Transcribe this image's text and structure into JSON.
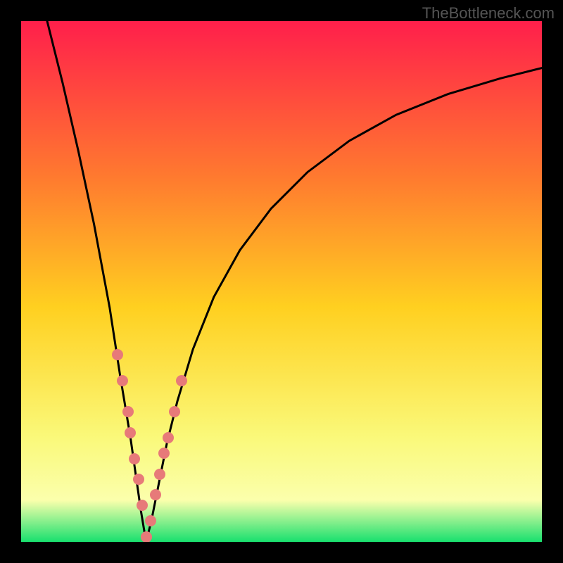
{
  "watermark": "TheBottleneck.com",
  "colors": {
    "frame": "#000000",
    "grad_top": "#ff1f4b",
    "grad_upper_mid": "#ff7a2f",
    "grad_mid": "#ffd020",
    "grad_lower_mid": "#faf97a",
    "grad_band": "#fbffac",
    "grad_bottom": "#18e06e",
    "curve": "#000000",
    "marker": "#e77a79"
  },
  "chart_data": {
    "type": "line",
    "title": "",
    "xlabel": "",
    "ylabel": "",
    "xlim": [
      0,
      100
    ],
    "ylim": [
      0,
      100
    ],
    "optimum_x": 24,
    "series": [
      {
        "name": "bottleneck-curve",
        "x": [
          5,
          8,
          11,
          14,
          17,
          19,
          21,
          22,
          23,
          24,
          25,
          26,
          27,
          28,
          30,
          33,
          37,
          42,
          48,
          55,
          63,
          72,
          82,
          92,
          100
        ],
        "values": [
          100,
          88,
          75,
          61,
          45,
          32,
          20,
          13,
          6,
          0,
          4,
          9,
          14,
          19,
          27,
          37,
          47,
          56,
          64,
          71,
          77,
          82,
          86,
          89,
          91
        ]
      }
    ],
    "markers": {
      "name": "highlight-dots",
      "x": [
        18.5,
        19.5,
        20.5,
        21.0,
        21.8,
        22.5,
        23.2,
        24.0,
        24.8,
        25.8,
        26.6,
        27.4,
        28.2,
        29.4,
        30.8
      ],
      "values": [
        36,
        31,
        25,
        21,
        16,
        12,
        7,
        1,
        4,
        9,
        13,
        17,
        20,
        25,
        31
      ]
    }
  }
}
